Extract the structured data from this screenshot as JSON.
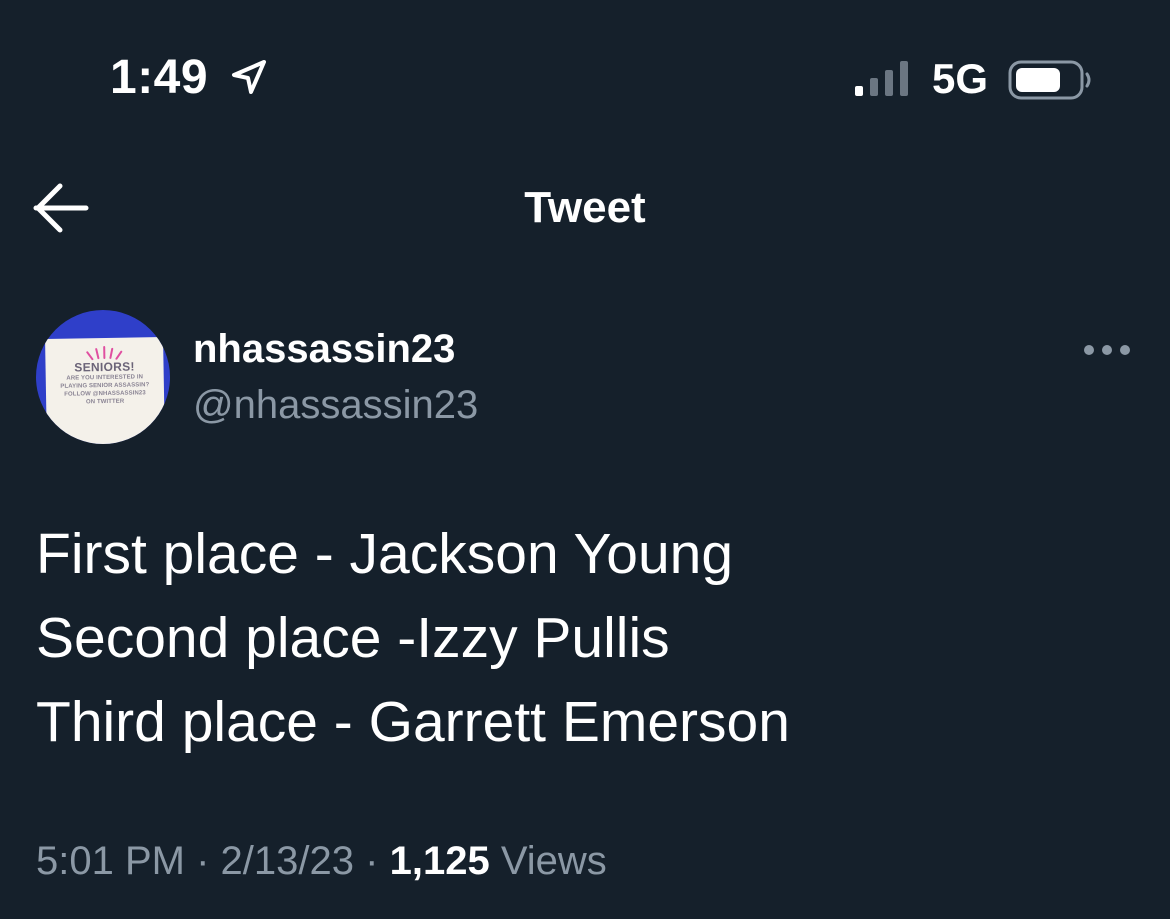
{
  "status_bar": {
    "time": "1:49",
    "network": "5G",
    "icons": [
      "location-arrow-icon",
      "cellular-signal-icon",
      "battery-icon"
    ]
  },
  "header": {
    "title": "Tweet",
    "back_icon": "arrow-left-icon"
  },
  "author": {
    "display_name": "nhassassin23",
    "handle": "@nhassassin23",
    "avatar": {
      "headline": "SENIORS!",
      "lines": [
        "ARE YOU INTERESTED IN",
        "PLAYING SENIOR ASSASSIN?",
        "FOLLOW @NHASSASSIN23",
        "ON TWITTER"
      ],
      "background": "#2f3fc9"
    },
    "more_icon": "more-horizontal-icon"
  },
  "tweet": {
    "lines": [
      "First place - Jackson Young",
      "Second place -Izzy Pullis",
      "Third place - Garrett Emerson"
    ]
  },
  "meta": {
    "time": "5:01 PM",
    "separator": "·",
    "date": "2/13/23",
    "views_count": "1,125",
    "views_label": "Views"
  },
  "colors": {
    "background": "#15202b",
    "text_primary": "#ffffff",
    "text_secondary": "#8b98a5"
  }
}
